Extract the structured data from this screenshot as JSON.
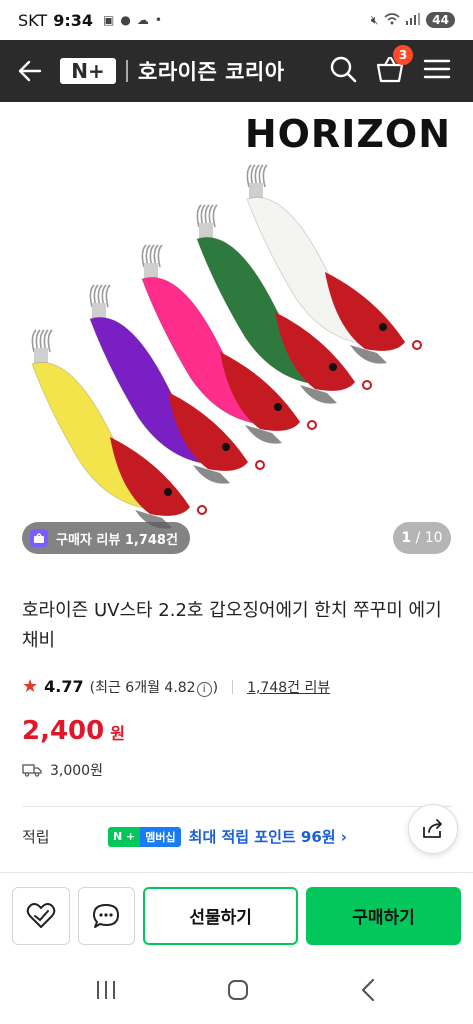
{
  "status_bar": {
    "carrier": "SKT",
    "time": "9:34",
    "battery": "44"
  },
  "header": {
    "logo": "N+",
    "store_name": "호라이즌 코리아",
    "cart_count": "3"
  },
  "hero": {
    "brand_logo_text": "HORIZON",
    "review_pill": "구매자 리뷰 1,748건",
    "page_current": "1",
    "page_total": "/ 10",
    "lure_colors": [
      "#f2e44a",
      "#7a1fc4",
      "#ff2d8c",
      "#2e7a3e",
      "#f4f4f0"
    ]
  },
  "product": {
    "title": "호라이즌 UV스타 2.2호 갑오징어에기 한치 쭈꾸미 에기 채비",
    "rating": "4.77",
    "rating_recent": "(최근 6개월 4.82",
    "rating_recent_close": ")",
    "review_link": "1,748건 리뷰",
    "price": "2,400",
    "price_unit": "원",
    "shipping": "3,000원"
  },
  "points": {
    "label": "적립",
    "badge_left": "N +",
    "badge_right": "멤버십",
    "text": "최대 적립 포인트 96원 ›"
  },
  "actions": {
    "gift": "선물하기",
    "buy": "구매하기"
  },
  "colors": {
    "accent_green": "#03c75a",
    "price_red": "#e0162b",
    "header_bg": "#2b2b2b"
  }
}
